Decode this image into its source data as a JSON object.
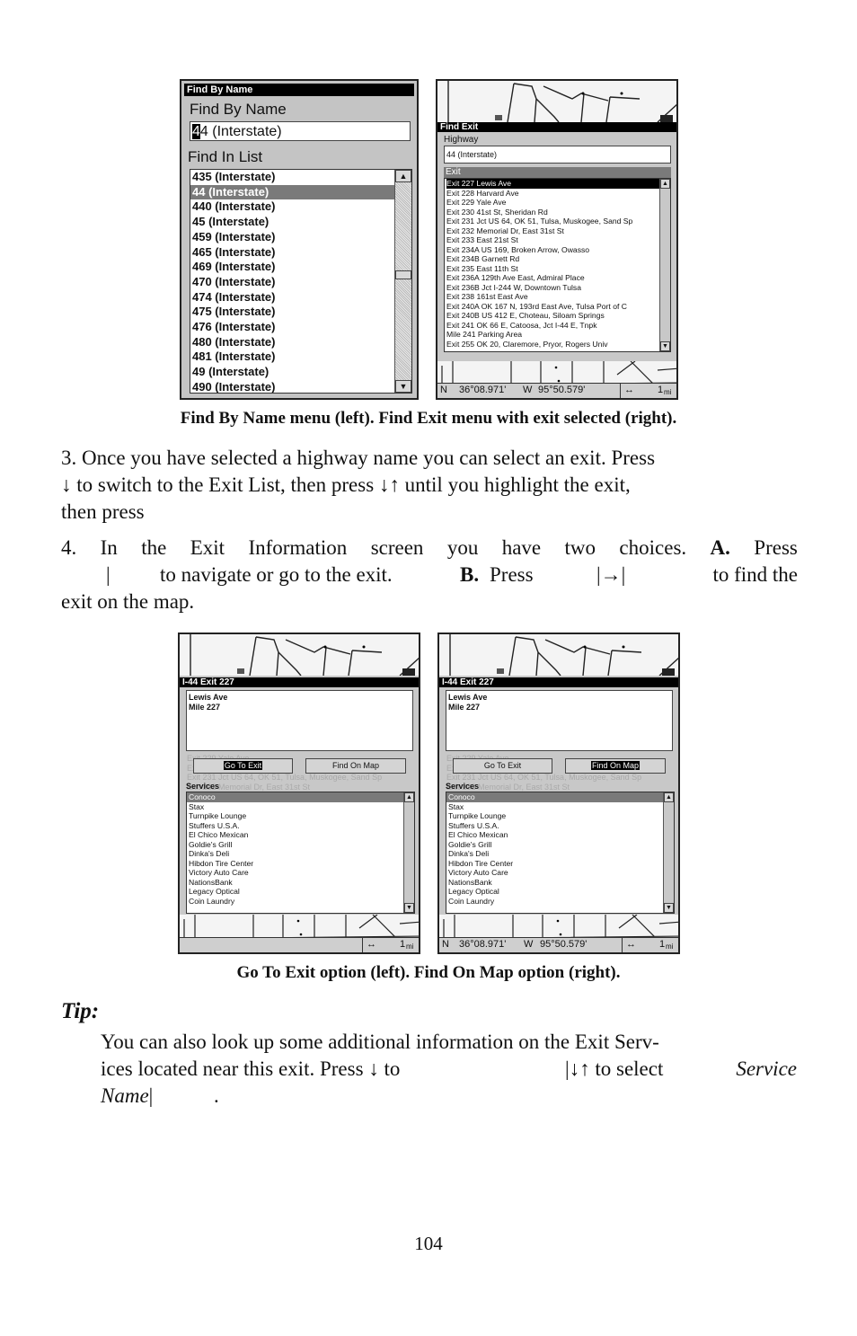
{
  "figure1": {
    "left_screen": {
      "titlebar": "Find By Name",
      "heading": "Find By Name",
      "input_cursor_char": "4",
      "input_rest": "4 (Interstate)",
      "list_heading": "Find In List",
      "items": [
        "435 (Interstate)",
        "44 (Interstate)",
        "440 (Interstate)",
        "45 (Interstate)",
        "459 (Interstate)",
        "465 (Interstate)",
        "469 (Interstate)",
        "470 (Interstate)",
        "474 (Interstate)",
        "475 (Interstate)",
        "476 (Interstate)",
        "480 (Interstate)",
        "481 (Interstate)",
        "49 (Interstate)",
        "490 (Interstate)"
      ],
      "selected_index": 1
    },
    "right_screen": {
      "titlebar": "Find Exit",
      "highway_label": "Highway",
      "highway_value": "44 (Interstate)",
      "exit_label": "Exit",
      "items": [
        "Exit 227 Lewis Ave",
        "Exit 228 Harvard Ave",
        "Exit 229 Yale Ave",
        "Exit 230 41st St, Sheridan Rd",
        "Exit 231 Jct US 64, OK 51, Tulsa, Muskogee, Sand Sp",
        "Exit 232 Memorial Dr, East 31st St",
        "Exit 233 East 21st St",
        "Exit 234A US 169, Broken Arrow, Owasso",
        "Exit 234B Garnett Rd",
        "Exit 235 East 11th St",
        "Exit 236A 129th Ave East, Admiral Place",
        "Exit 236B Jct I-244 W, Downtown Tulsa",
        "Exit 238 161st East Ave",
        "Exit 240A OK 167 N, 193rd East Ave, Tulsa Port of C",
        "Exit 240B US 412 E, Choteau, Siloam Springs",
        "Exit 241 OK 66 E, Catoosa, Jct I-44 E, Tnpk",
        "Mile 241 Parking Area",
        "Exit 255 OK 20, Claremore, Pryor, Rogers Univ"
      ],
      "selected_index": 0,
      "status": {
        "lat_prefix": "N",
        "lat": "36°08.971'",
        "lon_prefix": "W",
        "lon": "95°50.579'",
        "scale_icon": "↔",
        "scale": "1",
        "scale_unit": "mi"
      }
    },
    "caption": "Find By Name menu (left). Find Exit menu with exit selected (right)."
  },
  "paragraphs": {
    "p3": [
      "3. Once you have selected a highway name you can select an exit. Press",
      "↓ to switch to the Exit List, then press ↓↑ until you highlight the exit,",
      "then press"
    ],
    "p4_line1": [
      "4.",
      "In",
      "the",
      "Exit",
      "Information",
      "screen",
      "you",
      "have",
      "two",
      "choices."
    ],
    "p4_a": "A.",
    "p4_press": "Press",
    "p4_line2_a": "|",
    "p4_line2_b": "to navigate or go to the exit.",
    "p4_b": "B.",
    "p4_line2_c": "Press",
    "p4_line2_d": "|→|",
    "p4_line2_e": "to find the",
    "p4_line3": "exit on the map."
  },
  "figure2": {
    "screen": {
      "titlebar": "I-44 Exit 227",
      "info_lines": [
        "Lewis Ave",
        "Mile 227"
      ],
      "ghost_lines": [
        "Exit 229 Yale Ave",
        "Exit 230 41st St, Sheridan Rd",
        "Exit 231 Jct US 64, OK 51, Tulsa, Muskogee, Sand Sp",
        "Exit 232 Memorial Dr, East 31st St"
      ],
      "go_to_exit": "Go To Exit",
      "find_on_map": "Find On Map",
      "services_label": "Services",
      "services": [
        "Conoco",
        "Stax",
        "Turnpike Lounge",
        "Stuffers U.S.A.",
        "El Chico Mexican",
        "Goldie's Grill",
        "Dinka's Deli",
        "Hibdon Tire Center",
        "Victory Auto Care",
        "NationsBank",
        "Legacy Optical",
        "Coin Laundry"
      ],
      "selected_index": 0,
      "status": {
        "lat_prefix": "N",
        "lat": "36°08.971'",
        "lon_prefix": "W",
        "lon": "95°50.579'",
        "scale_icon": "↔",
        "scale": "1",
        "scale_unit": "mi"
      }
    },
    "left_focus": "Go To Exit",
    "right_focus": "Find On Map",
    "caption": "Go To Exit option (left). Find On Map option (right)."
  },
  "tip": {
    "label": "Tip:",
    "line1": "You can also look up some additional information on the Exit Serv-",
    "line2a": "ices located near this exit. Press ↓ to",
    "line2b": "|↓↑ to select",
    "line2c": "Service",
    "line3a": "Name",
    "line3b": "|",
    "line3c": "."
  },
  "page_number": "104"
}
